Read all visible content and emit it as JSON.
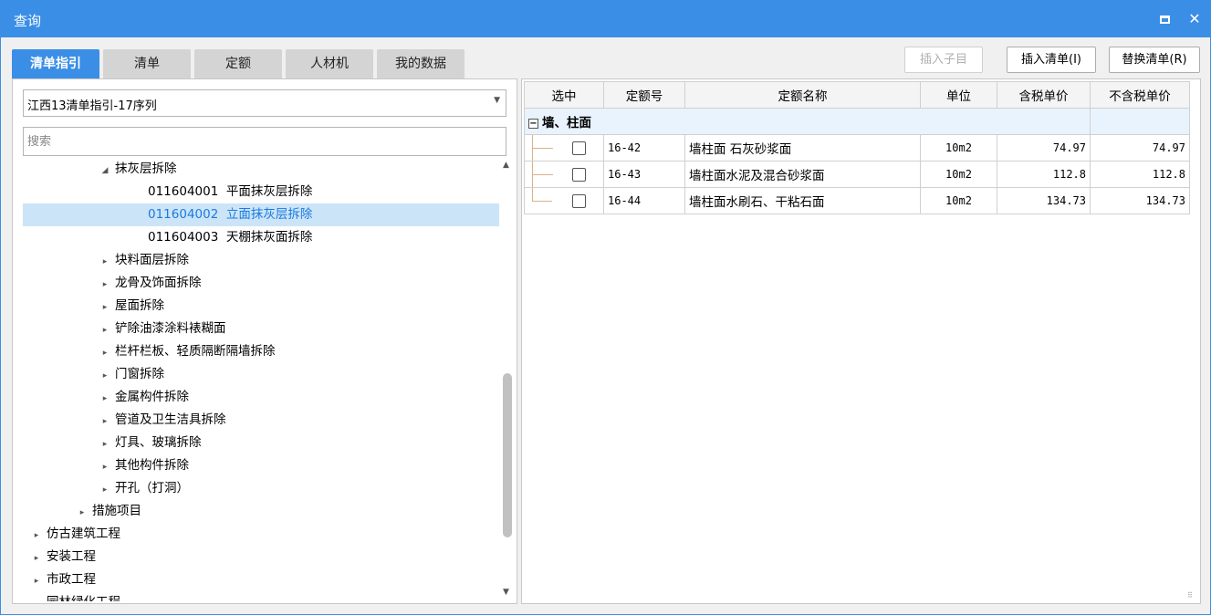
{
  "window": {
    "title": "查询"
  },
  "tabs": [
    {
      "label": "清单指引",
      "active": true
    },
    {
      "label": "清单",
      "active": false
    },
    {
      "label": "定额",
      "active": false
    },
    {
      "label": "人材机",
      "active": false
    },
    {
      "label": "我的数据",
      "active": false
    }
  ],
  "actions": {
    "insert_child": "插入子目",
    "insert_list": "插入清单(I)",
    "replace_list": "替换清单(R)"
  },
  "left": {
    "combo_value": "江西13清单指引-17序列",
    "search_placeholder": "搜索",
    "tree": [
      {
        "indent": 3,
        "arrow": "◢",
        "label": "抹灰层拆除"
      },
      {
        "indent": 5,
        "arrow": "",
        "label": "011604001  平面抹灰层拆除"
      },
      {
        "indent": 5,
        "arrow": "",
        "label": "011604002  立面抹灰层拆除",
        "selected": true
      },
      {
        "indent": 5,
        "arrow": "",
        "label": "011604003  天棚抹灰面拆除"
      },
      {
        "indent": 3,
        "arrow": "▸",
        "label": "块料面层拆除"
      },
      {
        "indent": 3,
        "arrow": "▸",
        "label": "龙骨及饰面拆除"
      },
      {
        "indent": 3,
        "arrow": "▸",
        "label": "屋面拆除"
      },
      {
        "indent": 3,
        "arrow": "▸",
        "label": "铲除油漆涂料裱糊面"
      },
      {
        "indent": 3,
        "arrow": "▸",
        "label": "栏杆栏板、轻质隔断隔墙拆除"
      },
      {
        "indent": 3,
        "arrow": "▸",
        "label": "门窗拆除"
      },
      {
        "indent": 3,
        "arrow": "▸",
        "label": "金属构件拆除"
      },
      {
        "indent": 3,
        "arrow": "▸",
        "label": "管道及卫生洁具拆除"
      },
      {
        "indent": 3,
        "arrow": "▸",
        "label": "灯具、玻璃拆除"
      },
      {
        "indent": 3,
        "arrow": "▸",
        "label": "其他构件拆除"
      },
      {
        "indent": 3,
        "arrow": "▸",
        "label": "开孔（打洞）"
      },
      {
        "indent": 2,
        "arrow": "▸",
        "label": "措施项目"
      },
      {
        "indent": 0,
        "arrow": "▸",
        "label": "仿古建筑工程"
      },
      {
        "indent": 0,
        "arrow": "▸",
        "label": "安装工程"
      },
      {
        "indent": 0,
        "arrow": "▸",
        "label": "市政工程"
      },
      {
        "indent": 0,
        "arrow": "▸",
        "label": "园林绿化工程"
      }
    ]
  },
  "grid": {
    "headers": [
      "选中",
      "定额号",
      "定额名称",
      "单位",
      "含税单价",
      "不含税单价"
    ],
    "group_label": "墙、柱面",
    "rows": [
      {
        "code": "16-42",
        "name": "墙柱面 石灰砂浆面",
        "unit": "10m2",
        "price_tax": "74.97",
        "price_notax": "74.97"
      },
      {
        "code": "16-43",
        "name": "墙柱面水泥及混合砂浆面",
        "unit": "10m2",
        "price_tax": "112.8",
        "price_notax": "112.8"
      },
      {
        "code": "16-44",
        "name": "墙柱面水刷石、干粘石面",
        "unit": "10m2",
        "price_tax": "134.73",
        "price_notax": "134.73"
      }
    ]
  }
}
